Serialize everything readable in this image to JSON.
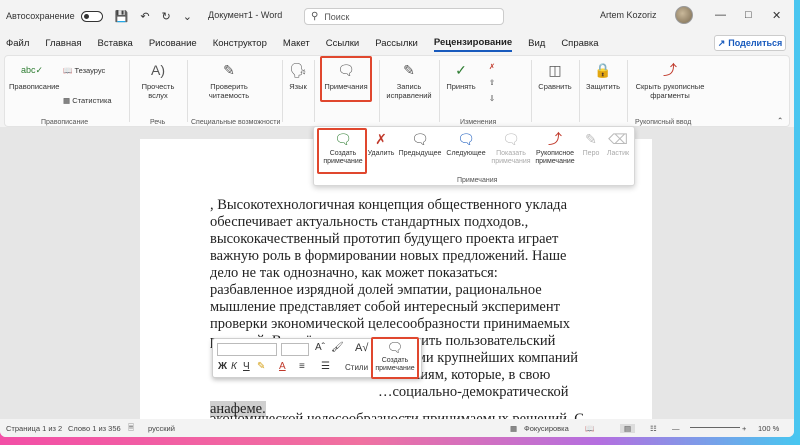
{
  "titlebar": {
    "autosave_label": "Автосохранение",
    "doc_title": "Документ1 - Word",
    "search_placeholder": "Поиск",
    "user_name": "Artem Kozoriz"
  },
  "tabs": [
    "Файл",
    "Главная",
    "Вставка",
    "Рисование",
    "Конструктор",
    "Макет",
    "Ссылки",
    "Рассылки",
    "Рецензирование",
    "Вид",
    "Справка"
  ],
  "active_tab": "Рецензирование",
  "share_label": "Поделиться",
  "ribbon": {
    "spelling": "Правописание",
    "thesaurus": "Тезаурус",
    "statistics": "Статистика",
    "group_spelling": "Правописание",
    "read_aloud": "Прочесть вслух",
    "group_speech": "Речь",
    "check_access": "Проверить читаемость",
    "group_access": "Специальные возможности",
    "language": "Язык",
    "comments": "Примечания",
    "track_changes": "Запись исправлений",
    "accept": "Принять",
    "group_changes": "Изменения",
    "compare": "Сравнить",
    "protect": "Защитить",
    "hide_ink": "Скрыть рукописные фрагменты",
    "group_ink": "Рукописный ввод"
  },
  "comments_panel": {
    "new_comment": "Создать примечание",
    "delete": "Удалить",
    "previous": "Предыдущее",
    "next": "Следующее",
    "show_comments": "Показать примечания",
    "ink_comment": "Рукописное примечание",
    "pen": "Перо",
    "eraser": "Ластик",
    "group_label": "Примечания"
  },
  "document": {
    "lines": [
      ", Высокотехнологичная концепция общественного уклада",
      "обеспечивает актуальность стандартных подходов.,",
      "высококачественный прототип будущего проекта играет",
      "важную роль в формировании новых предложений. Наше",
      "дело не так однозначно, как может показаться:",
      "разбавленное изрядной долей эмпатии, рациональное",
      "мышление представляет собой интересный эксперимент",
      "проверки экономической целесообразности принимаемых",
      "решений. В своём желании улучшить пользовательский"
    ],
    "line10_tail": "…ниями крупнейших компаний",
    "line11_tail": "…ниям, которые, в свою",
    "line12_tail": "…социально-демократической",
    "highlight_word": "анафеме.",
    "para2": "экономической целесообразности принимаемых решений. С"
  },
  "mini_toolbar": {
    "styles": "Стили",
    "new_comment": "Создать примечание"
  },
  "status": {
    "page": "Страница 1 из 2",
    "words": "Слово 1 из 356",
    "language": "русский",
    "focus": "Фокусировка",
    "zoom": "100 %"
  }
}
